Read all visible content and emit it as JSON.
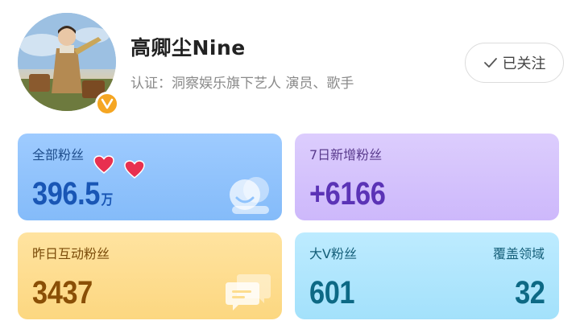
{
  "profile": {
    "name": "高卿尘Nine",
    "certification": "认证：洞察娱乐旗下艺人 演员、歌手",
    "follow_label": "已关注"
  },
  "stats": {
    "total_fans": {
      "label": "全部粉丝",
      "value": "396.5",
      "unit": "万"
    },
    "new_fans_7d": {
      "label": "7日新增粉丝",
      "value": "+6166"
    },
    "interactive_fans_yesterday": {
      "label": "昨日互动粉丝",
      "value": "3437"
    },
    "big_v_fans": {
      "label": "大V粉丝",
      "value": "601"
    },
    "coverage": {
      "label": "覆盖领域",
      "value": "32"
    }
  },
  "icons": {
    "verified": "verified-v-badge-icon",
    "follow_check": "check-icon",
    "total_fans": "smiley-faces-icon",
    "new_fans": "bar-chart-icon",
    "interactive": "chat-bubble-icon",
    "decoration": "heart-icon"
  },
  "colors": {
    "card_blue": "#8fc3fd",
    "card_purple": "#d4c3fc",
    "card_yellow": "#fddd8f",
    "card_cyan": "#afe6fd",
    "badge": "#f5a623",
    "heart": "#e8304f"
  }
}
